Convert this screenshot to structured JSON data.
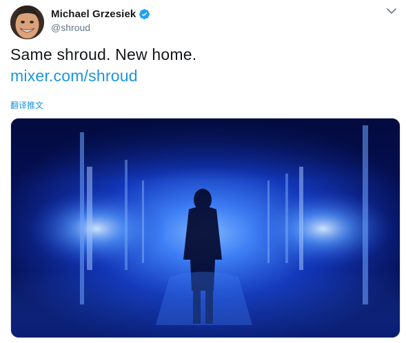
{
  "author": {
    "display_name": "Michael Grzesiek",
    "handle": "@shroud",
    "verified": true,
    "avatar_icon": "avatar-photo",
    "verified_icon": "verified-badge-icon"
  },
  "tweet": {
    "text_line1": "Same shroud. New home.",
    "link_text": "mixer.com/shroud",
    "translate_label": "翻译推文"
  },
  "menu": {
    "caret_icon": "chevron-down-icon"
  },
  "media": {
    "type": "video",
    "description_icon": "video-thumbnail"
  },
  "colors": {
    "text_primary": "#14171a",
    "text_secondary": "#657786",
    "link": "#1b95e0",
    "verified": "#1da1f2",
    "media_bg": "#0a1a6e"
  }
}
